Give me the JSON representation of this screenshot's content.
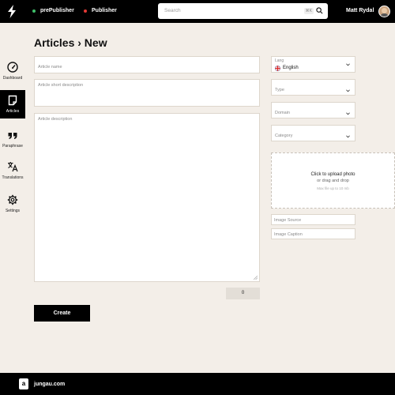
{
  "header": {
    "env_pre": "prePublisher",
    "env_pub": "Publisher",
    "search_placeholder": "Search",
    "search_shortcut": "⌘K",
    "user_name": "Matt Rydal"
  },
  "sidebar": {
    "items": [
      {
        "label": "Dashboard",
        "icon": "gauge-icon"
      },
      {
        "label": "Articles",
        "icon": "document-icon",
        "active": true
      },
      {
        "label": "Paraphrase",
        "icon": "quote-icon"
      },
      {
        "label": "Translations",
        "icon": "translate-icon"
      },
      {
        "label": "Settings",
        "icon": "gear-icon"
      }
    ]
  },
  "page": {
    "title": "Articles › New"
  },
  "form": {
    "name_placeholder": "Article name",
    "short_desc_placeholder": "Article short description",
    "desc_placeholder": "Article description",
    "char_count": "0",
    "create_label": "Create",
    "lang_label": "Lang",
    "lang_value": "English",
    "type_placeholder": "Type",
    "domain_placeholder": "Domain",
    "category_placeholder": "Category",
    "upload_line1": "Click to upload photo",
    "upload_line2": "or drag and drop",
    "upload_line3": "Max file up to 10 mb",
    "image_source_placeholder": "Image Source",
    "image_caption_placeholder": "Image Caption"
  },
  "footer": {
    "logo_letter": "a",
    "site": "jungau.com"
  },
  "colors": {
    "background": "#f3eee8",
    "bar": "#000000",
    "env_pre_dot": "#3fbf6a",
    "env_pub_dot": "#e53935"
  }
}
